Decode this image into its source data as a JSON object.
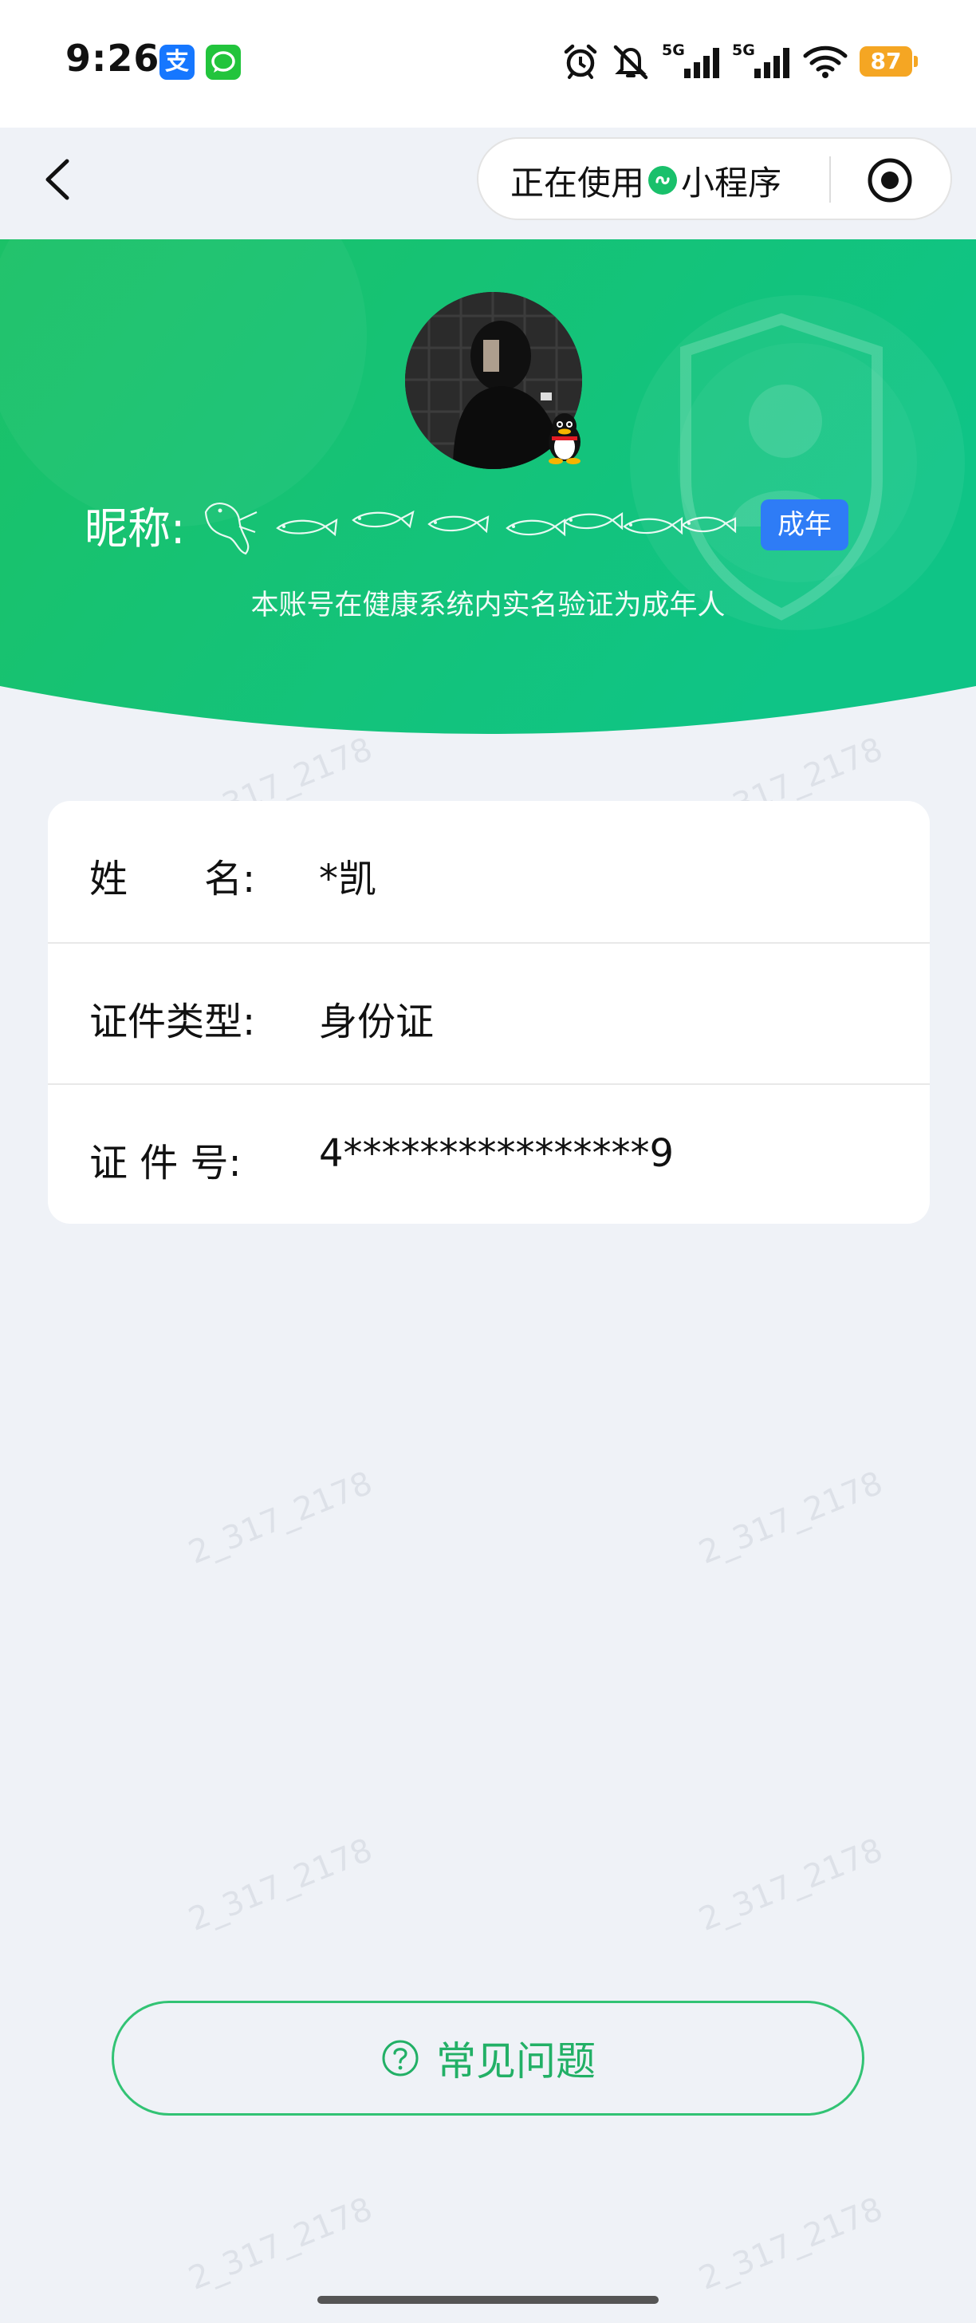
{
  "status_bar": {
    "time": "9:26",
    "app_icons": [
      {
        "name": "alipay-icon",
        "glyph": "支"
      },
      {
        "name": "message-icon",
        "glyph": "💬"
      }
    ],
    "signal_label_1": "5G",
    "signal_label_2": "5G",
    "battery_level": "87"
  },
  "nav": {
    "capsule_label_part1": "正在使用",
    "capsule_label_part2": "小程序"
  },
  "profile": {
    "nickname_label": "昵称:",
    "adult_badge": "成年",
    "verify_text": "本账号在健康系统内实名验证为成年人"
  },
  "info": {
    "rows": [
      {
        "label": "姓　　名:",
        "value": "*凯"
      },
      {
        "label": "证件类型:",
        "value": "身份证"
      },
      {
        "label": "证 件 号:",
        "value": "4****************9"
      }
    ]
  },
  "faq": {
    "label": "常见问题"
  },
  "colors": {
    "brand_green": "#19c06b",
    "badge_blue": "#2e7cf6",
    "battery_orange": "#f5a623",
    "page_bg": "#eff2f7"
  }
}
